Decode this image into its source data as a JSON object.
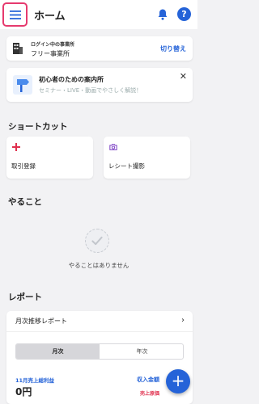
{
  "header": {
    "title": "ホーム"
  },
  "office": {
    "label": "ログイン中の事業所",
    "name": "フリー事業所",
    "switch_label": "切り替え"
  },
  "guide": {
    "title": "初心者のための案内所",
    "subtitle": "セミナー・LIVE・動画でやさしく解説！",
    "close": "✕"
  },
  "shortcuts": {
    "heading": "ショートカット",
    "items": [
      {
        "label": "取引登録",
        "icon": "plus-icon",
        "color": "#e0304e"
      },
      {
        "label": "レシート撮影",
        "icon": "camera-icon",
        "color": "#7b3fc4"
      }
    ]
  },
  "todo": {
    "heading": "やること",
    "empty_text": "やることはありません"
  },
  "report": {
    "heading": "レポート",
    "monthly_title": "月次推移レポート",
    "chevron": "›",
    "tabs": [
      {
        "label": "月次",
        "selected": true
      },
      {
        "label": "年次",
        "selected": false
      }
    ],
    "month_label": "11月売上総利益",
    "month_value": "0円",
    "income_label": "収入金額",
    "sales_label": "売上原価"
  },
  "colors": {
    "accent": "#2563d8",
    "highlight": "#e63a6e",
    "expense": "#e0304e"
  }
}
